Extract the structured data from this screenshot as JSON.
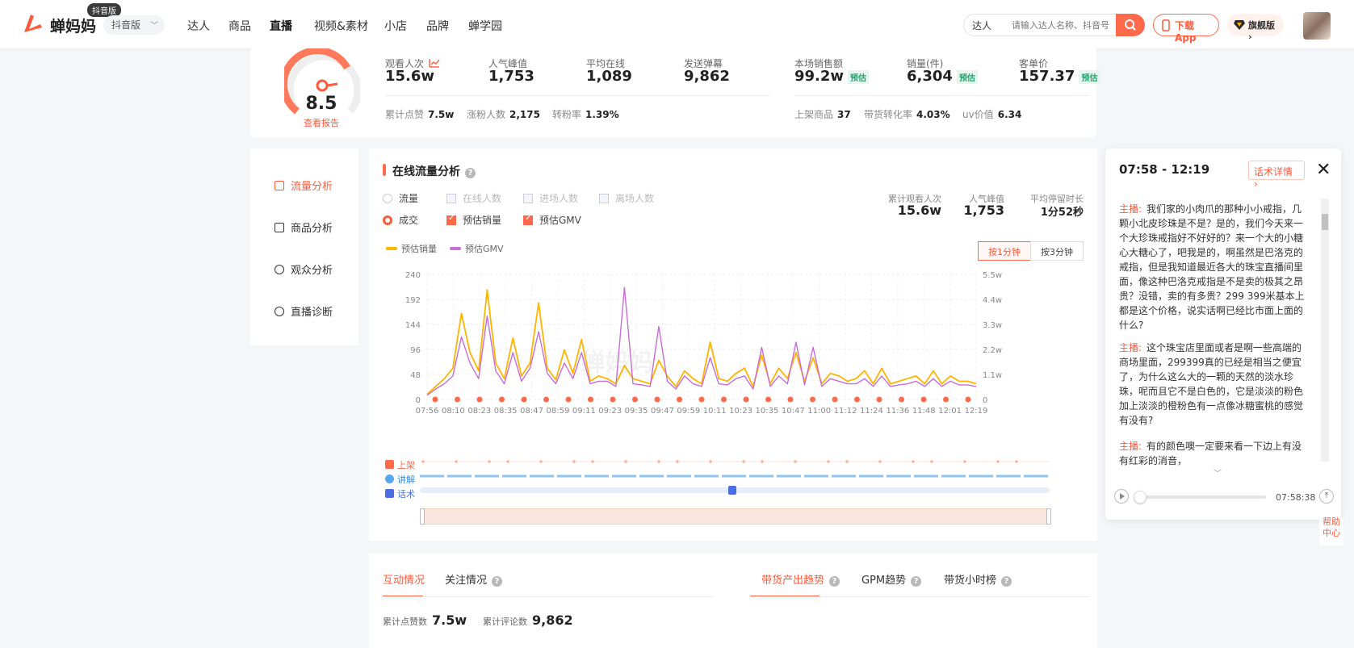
{
  "nav": {
    "brand": "蝉妈妈",
    "badge": "抖音版",
    "version_select": "抖音版",
    "items": [
      "达人",
      "商品",
      "直播",
      "视频&素材",
      "小店",
      "品牌",
      "蝉学园"
    ],
    "active_index": 2,
    "search_type": "达人",
    "search_placeholder": "请输入达人名称、抖音号",
    "download_label": "下载App",
    "flagship_label": "旗舰版"
  },
  "stats": {
    "score": "8.5",
    "report_link": "查看报告",
    "primary": [
      {
        "label": "观看人次",
        "value": "15.6w",
        "tag": ""
      },
      {
        "label": "人气峰值",
        "value": "1,753",
        "tag": ""
      },
      {
        "label": "平均在线",
        "value": "1,089",
        "tag": ""
      },
      {
        "label": "发送弹幕",
        "value": "9,862",
        "tag": ""
      },
      {
        "label": "本场销售额",
        "value": "99.2w",
        "tag": "预估"
      },
      {
        "label": "销量(件)",
        "value": "6,304",
        "tag": "预估"
      },
      {
        "label": "客单价",
        "value": "157.37",
        "tag": "预估"
      }
    ],
    "secondary": [
      {
        "label": "累计点赞",
        "value": "7.5w"
      },
      {
        "label": "涨粉人数",
        "value": "2,175"
      },
      {
        "label": "转粉率",
        "value": "1.39%"
      },
      {
        "label": "上架商品",
        "value": "37"
      },
      {
        "label": "带货转化率",
        "value": "4.03%"
      },
      {
        "label": "uv价值",
        "value": "6.34"
      }
    ]
  },
  "sidemenu": {
    "items": [
      "流量分析",
      "商品分析",
      "观众分析",
      "直播诊断"
    ],
    "active_index": 0
  },
  "traffic": {
    "title": "在线流量分析",
    "row1": {
      "radio": "流量",
      "checks": [
        "在线人数",
        "进场人数",
        "离场人数"
      ]
    },
    "row2": {
      "radio": "成交",
      "checks": [
        "预估销量",
        "预估GMV"
      ]
    },
    "summary": [
      {
        "label": "累计观看人次",
        "value": "15.6w"
      },
      {
        "label": "人气峰值",
        "value": "1,753"
      },
      {
        "label": "平均停留时长",
        "value": "1分52秒"
      }
    ],
    "segments": [
      "按1分钟",
      "按3分钟"
    ],
    "tracks": [
      "上架",
      "讲解",
      "话术"
    ],
    "watermark": "蝉妈妈"
  },
  "chart_data": {
    "type": "line",
    "x": [
      "07:56",
      "08:10",
      "08:23",
      "08:35",
      "08:47",
      "08:59",
      "09:11",
      "09:23",
      "09:35",
      "09:47",
      "09:59",
      "10:11",
      "10:23",
      "10:35",
      "10:47",
      "11:00",
      "11:12",
      "11:24",
      "11:36",
      "11:48",
      "12:01",
      "12:19"
    ],
    "y_left_ticks": [
      "0",
      "48",
      "96",
      "144",
      "192",
      "240"
    ],
    "y_right_ticks": [
      "0",
      "1.1w",
      "2.2w",
      "3.3w",
      "4.4w",
      "5.5w"
    ],
    "ylim_left": [
      0,
      240
    ],
    "ylim_right": [
      0,
      55000
    ],
    "legend_placement": "top-left",
    "grid": true,
    "series": [
      {
        "name": "预估销量",
        "color": "#ffb400",
        "axis": "left",
        "values": [
          10,
          25,
          40,
          60,
          165,
          90,
          55,
          210,
          70,
          40,
          118,
          45,
          70,
          185,
          60,
          38,
          95,
          50,
          115,
          35,
          45,
          40,
          30,
          65,
          40,
          35,
          30,
          75,
          45,
          25,
          55,
          40,
          30,
          110,
          40,
          35,
          50,
          60,
          25,
          85,
          30,
          60,
          40,
          90,
          35,
          80,
          30,
          50,
          45,
          35,
          40,
          55,
          30,
          60,
          30,
          35,
          40,
          45,
          30,
          55,
          30,
          45,
          35,
          35,
          30
        ]
      },
      {
        "name": "预估GMV",
        "color": "#c86dd7",
        "axis": "left",
        "values": [
          8,
          20,
          30,
          45,
          120,
          70,
          40,
          160,
          55,
          30,
          90,
          35,
          60,
          130,
          50,
          30,
          70,
          40,
          90,
          30,
          35,
          35,
          25,
          215,
          30,
          28,
          25,
          140,
          35,
          20,
          45,
          30,
          25,
          80,
          30,
          28,
          40,
          45,
          20,
          100,
          25,
          45,
          30,
          110,
          28,
          100,
          25,
          40,
          35,
          30,
          30,
          40,
          25,
          45,
          25,
          28,
          30,
          35,
          25,
          40,
          25,
          35,
          28,
          28,
          25
        ]
      }
    ]
  },
  "script_panel": {
    "time_range": "07:58 - 12:19",
    "detail_link": "话术详情",
    "close": "✕",
    "paragraphs": [
      {
        "speaker": "主播:",
        "text": "我们家的小肉爪的那种小小戒指，几颗小北皮珍珠是不是？是的，我们今天来一个大珍珠戒指好不好好的？来一个大的小糖心大糖心了，吧我是的，啊虽然是巴洛克的戒指，但是我知道最近各大的珠宝直播间里面，像这种巴洛克戒指是不是卖的极其之昂贵？没错，卖的有多贵？299 399米基本上都是这个价格，说实话啊已经比市面上面的什么?"
      },
      {
        "speaker": "主播:",
        "text": "这个珠宝店里面或者是啊一些高端的商场里面，299399真的已经是相当之便宜了，为什么这么大的一颗的天然的淡水珍珠，呢而且它不是白色的，它是淡淡的粉色加上淡淡的橙粉色有一点像冰糖蜜桃的感觉有没有?"
      },
      {
        "speaker": "主播:",
        "text": "有的颜色噢一定要来看一下边上有没有红彩的消音，"
      }
    ],
    "timestamp": "07:58:38"
  },
  "help": "帮助中心",
  "bottom": {
    "left_tabs": [
      "互动情况",
      "关注情况"
    ],
    "right_tabs": [
      "带货产出趋势",
      "GPM趋势",
      "带货小时榜"
    ],
    "stats": [
      {
        "label": "累计点赞数",
        "value": "7.5w"
      },
      {
        "label": "累计评论数",
        "value": "9,862"
      }
    ]
  }
}
